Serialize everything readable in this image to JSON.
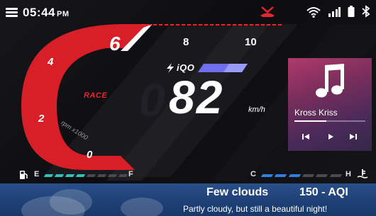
{
  "status_bar": {
    "time": "05:44",
    "ampm": "PM",
    "icons": [
      "menu-icon",
      "missed-call-icon",
      "wifi-icon",
      "signal-icon",
      "battery-icon",
      "bluetooth-icon"
    ]
  },
  "tachometer": {
    "ticks": [
      "0",
      "2",
      "4",
      "6",
      "8",
      "10"
    ],
    "mode": "RACE",
    "unit_label": "rpm x1000",
    "accent": "#e8262d"
  },
  "speedometer": {
    "brand": "iQO",
    "value": "82",
    "unit": "km/h"
  },
  "media": {
    "track": "Kross Kriss",
    "progress": 0.45,
    "icons": [
      "music-note-icon",
      "previous-icon",
      "play-icon",
      "next-icon"
    ]
  },
  "fuel": {
    "empty": "E",
    "full": "F",
    "level_segments": 4,
    "total_segments": 8,
    "color": "#2cc4b8"
  },
  "temperature": {
    "cold": "C",
    "hot": "H",
    "level_segments": 3,
    "total_segments": 6,
    "color": "#2f7fe0"
  },
  "weather": {
    "title": "Few clouds",
    "aqi": "150 - AQI",
    "subtitle": "Partly cloudy, but still a beautiful night!"
  }
}
